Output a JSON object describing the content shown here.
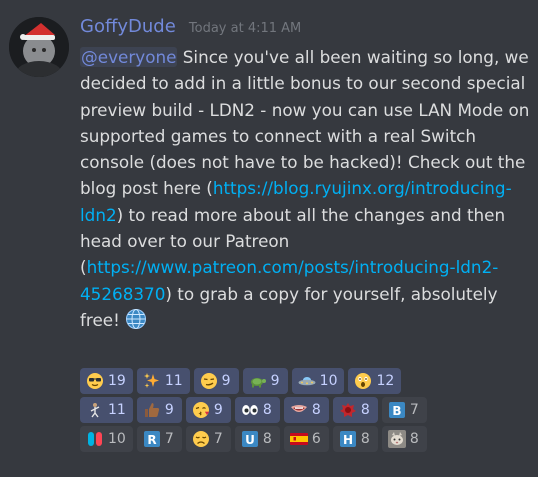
{
  "message": {
    "username": "GoffyDude",
    "timestamp": "Today at 4:11 AM",
    "mention": "@everyone",
    "text_part1": " Since you've all been waiting so long, we decided to add in a little bonus to our second special preview build - LDN2 - now you can use LAN Mode on supported games to connect with a real Switch console (does not have to be hacked)! Check out the blog post here (",
    "link1": "https://blog.ryujinx.org/introducing-ldn2",
    "text_part2": ") to read more about all the changes and then head over to our Patreon (",
    "link2": "https://www.patreon.com/posts/introducing-ldn2-45268370",
    "text_part3": ") to grab a copy for yourself, absolutely free! "
  },
  "reactions": [
    [
      {
        "name": "sunglasses-emoji",
        "count": "19",
        "me": true
      },
      {
        "name": "sparkles-emoji",
        "count": "11",
        "me": true
      },
      {
        "name": "smirk-emoji",
        "count": "9",
        "me": true
      },
      {
        "name": "turtle-emoji",
        "count": "9",
        "me": true
      },
      {
        "name": "ufo-emoji",
        "count": "10",
        "me": true
      },
      {
        "name": "astonished-emoji",
        "count": "12",
        "me": true
      }
    ],
    [
      {
        "name": "pointing-custom-emoji",
        "count": "11",
        "me": true
      },
      {
        "name": "thumbsup-dark-emoji",
        "count": "9",
        "me": true
      },
      {
        "name": "kissing-heart-emoji",
        "count": "9",
        "me": true
      },
      {
        "name": "eyes-emoji",
        "count": "8",
        "me": true
      },
      {
        "name": "mouth-custom-emoji",
        "count": "8",
        "me": true
      },
      {
        "name": "red-blob-emoji",
        "count": "8",
        "me": true
      },
      {
        "name": "letter-b-emoji",
        "count": "7",
        "me": false
      }
    ],
    [
      {
        "name": "switch-controller-emoji",
        "count": "10",
        "me": false
      },
      {
        "name": "letter-r-emoji",
        "count": "7",
        "me": false
      },
      {
        "name": "disappointed-emoji",
        "count": "7",
        "me": false
      },
      {
        "name": "letter-u-emoji",
        "count": "8",
        "me": false
      },
      {
        "name": "spain-flag-emoji",
        "count": "6",
        "me": false
      },
      {
        "name": "letter-h-emoji",
        "count": "8",
        "me": false
      },
      {
        "name": "cat-custom-emoji",
        "count": "8",
        "me": false
      }
    ]
  ],
  "colors": {
    "background": "#36393f",
    "username": "#7289da",
    "link": "#00b0f4",
    "text": "#dcddde",
    "timestamp": "#72767d"
  }
}
